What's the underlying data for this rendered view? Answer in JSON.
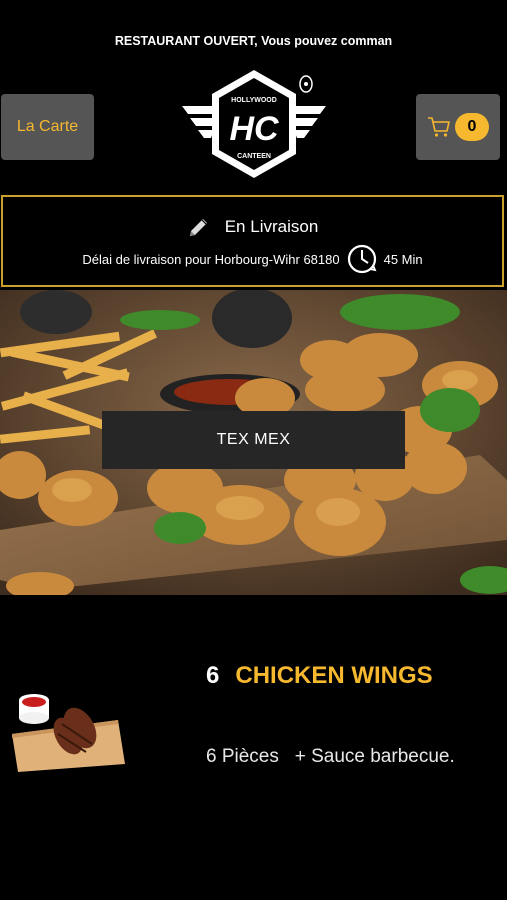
{
  "banner": {
    "text": "RESTAURANT OUVERT, Vous pouvez comman"
  },
  "header": {
    "menu_label": "La Carte",
    "cart_count": "0",
    "logo": {
      "top": "HOLLYWOOD",
      "initials": "HC",
      "bottom": "CANTEEN"
    }
  },
  "delivery": {
    "title": "En Livraison",
    "info": "Délai de livraison pour Horbourg-Wihr 68180",
    "time": "45 Min"
  },
  "category": {
    "label": "TEX MEX"
  },
  "product": {
    "quantity": "6",
    "name": "CHICKEN WINGS",
    "description": "6 Pièces   + Sauce barbecue."
  },
  "colors": {
    "accent": "#f5b82e",
    "button_gray": "#555555",
    "border_gold": "#c9a02a"
  },
  "icons": [
    "cart-icon",
    "pencil-icon",
    "clock-icon"
  ]
}
